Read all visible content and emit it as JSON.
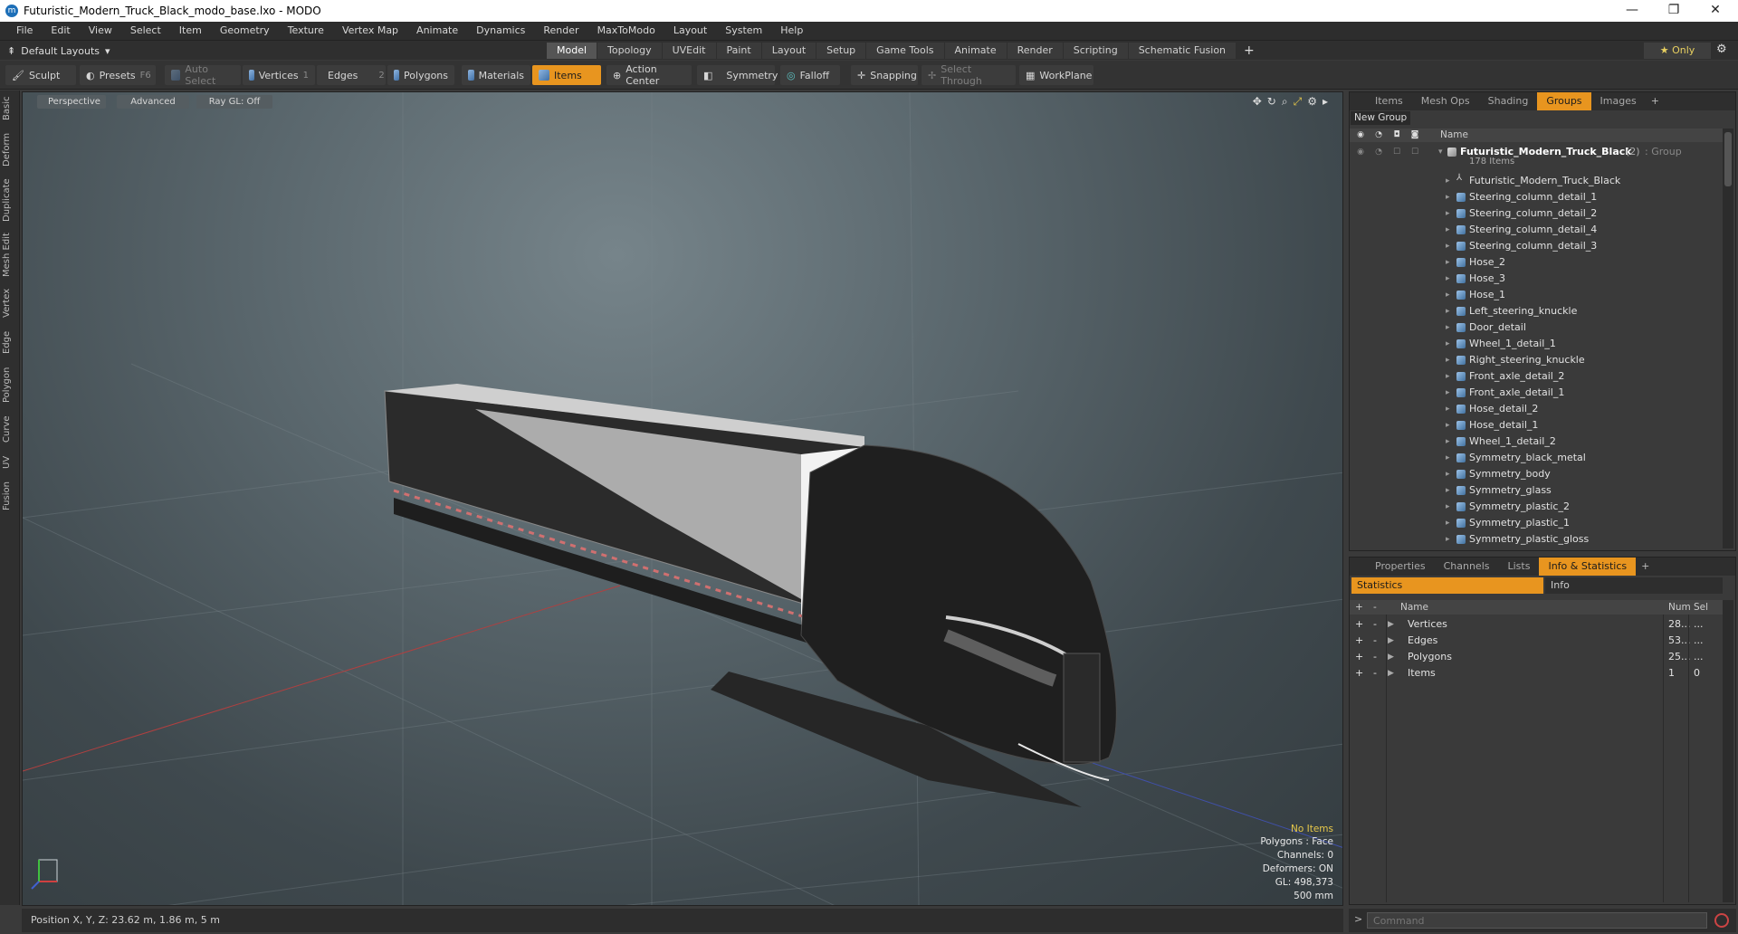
{
  "window": {
    "title": "Futuristic_Modern_Truck_Black_modo_base.lxo - MODO",
    "min": "—",
    "max": "❐",
    "close": "✕"
  },
  "menu": [
    "File",
    "Edit",
    "View",
    "Select",
    "Item",
    "Geometry",
    "Texture",
    "Vertex Map",
    "Animate",
    "Dynamics",
    "Render",
    "MaxToModo",
    "Layout",
    "System",
    "Help"
  ],
  "layoutbar": {
    "layout": "Default Layouts",
    "tabs": [
      "Model",
      "Topology",
      "UVEdit",
      "Paint",
      "Layout",
      "Setup",
      "Game Tools",
      "Animate",
      "Render",
      "Scripting",
      "Schematic Fusion"
    ],
    "active_tab": "Model",
    "plus": "+",
    "only": "★ Only"
  },
  "toolbar": {
    "sculpt": "Sculpt",
    "presets": "Presets",
    "presets_key": "F6",
    "auto_select": "Auto Select",
    "vertices": "Vertices",
    "vertices_key": "1",
    "edges": "Edges",
    "edges_key": "2",
    "polygons": "Polygons",
    "materials": "Materials",
    "items": "Items",
    "action_center": "Action Center",
    "symmetry": "Symmetry",
    "falloff": "Falloff",
    "snapping": "Snapping",
    "select_through": "Select Through",
    "workplane": "WorkPlane"
  },
  "lefttabs": [
    "Basic",
    "Deform",
    "Duplicate",
    "Mesh Edit",
    "Vertex",
    "Edge",
    "Polygon",
    "Curve",
    "UV",
    "Fusion"
  ],
  "viewport": {
    "perspective": "Perspective",
    "advanced": "Advanced",
    "raygl": "Ray GL: Off",
    "hud": {
      "no_items": "No Items",
      "polygons": "Polygons : Face",
      "channels": "Channels: 0",
      "deformers": "Deformers: ON",
      "gl": "GL: 498,373",
      "scale": "500 mm"
    }
  },
  "status": {
    "position": "Position X, Y, Z:   23.62 m, 1.86 m, 5 m"
  },
  "items_panel": {
    "tabs": [
      "Items",
      "Mesh Ops",
      "Shading",
      "Groups",
      "Images"
    ],
    "active_tab": "Groups",
    "plus": "+",
    "new_group": "New Group",
    "name_header": "Name",
    "group": {
      "name": "Futuristic_Modern_Truck_Black",
      "count": "(2)",
      "type": ": Group",
      "items": "178 Items"
    },
    "children": [
      "Futuristic_Modern_Truck_Black",
      "Steering_column_detail_1",
      "Steering_column_detail_2",
      "Steering_column_detail_4",
      "Steering_column_detail_3",
      "Hose_2",
      "Hose_3",
      "Hose_1",
      "Left_steering_knuckle",
      "Door_detail",
      "Wheel_1_detail_1",
      "Right_steering_knuckle",
      "Front_axle_detail_2",
      "Front_axle_detail_1",
      "Hose_detail_2",
      "Hose_detail_1",
      "Wheel_1_detail_2",
      "Symmetry_black_metal",
      "Symmetry_body",
      "Symmetry_glass",
      "Symmetry_plastic_2",
      "Symmetry_plastic_1",
      "Symmetry_plastic_gloss"
    ]
  },
  "stats_panel": {
    "tabs": [
      "Properties",
      "Channels",
      "Lists",
      "Info & Statistics"
    ],
    "active_tab": "Info & Statistics",
    "plus": "+",
    "sub_statistics": "Statistics",
    "sub_info": "Info",
    "headers": {
      "add": "+",
      "sub": "-",
      "name": "Name",
      "num": "Num",
      "sel": "Sel"
    },
    "rows": [
      {
        "name": "Vertices",
        "num": "28...",
        "sel": "..."
      },
      {
        "name": "Edges",
        "num": "53...",
        "sel": "..."
      },
      {
        "name": "Polygons",
        "num": "25...",
        "sel": "..."
      },
      {
        "name": "Items",
        "num": "1",
        "sel": "0"
      }
    ]
  },
  "command": {
    "prompt": ">",
    "placeholder": "Command"
  },
  "colors": {
    "accent": "#e8951f",
    "viewport_bg": "#5a676d",
    "panel_bg": "#3a3a3a"
  }
}
